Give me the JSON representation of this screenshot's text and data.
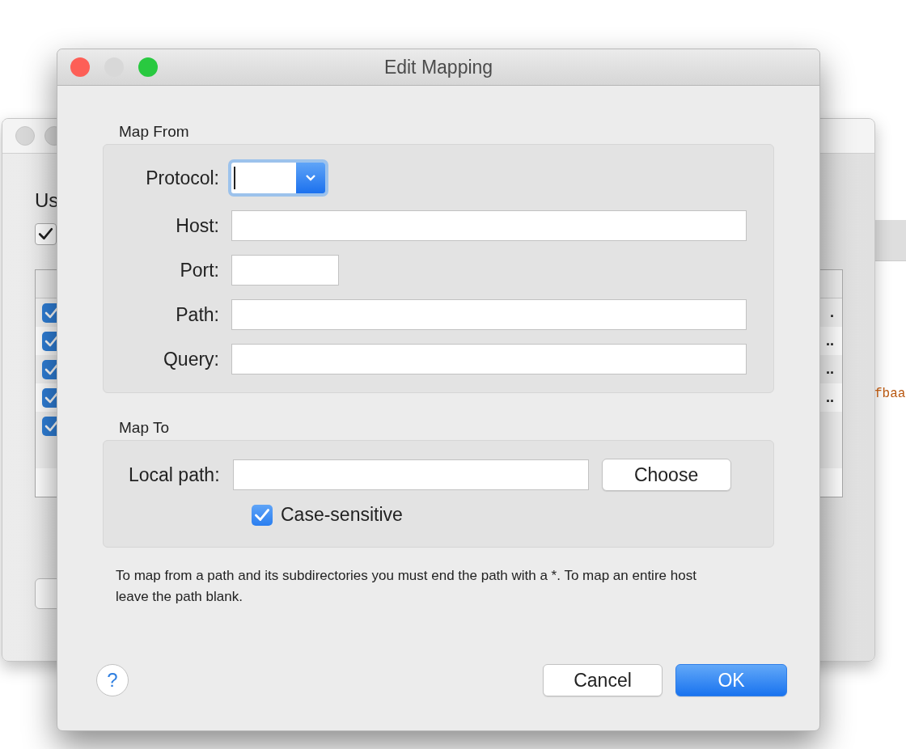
{
  "background_window": {
    "heading": "Us",
    "option_checked": true,
    "rows": [
      {
        "checked": true,
        "text": "."
      },
      {
        "checked": true,
        "text": ".."
      },
      {
        "checked": true,
        "text": ".."
      },
      {
        "checked": true,
        "text": ".."
      },
      {
        "checked": true,
        "text": ""
      }
    ]
  },
  "third_window": {
    "text": "fbaa"
  },
  "dialog": {
    "title": "Edit Mapping",
    "map_from": {
      "title": "Map From",
      "protocol": {
        "label": "Protocol:",
        "focused": true
      },
      "fields": [
        {
          "label": "Host:",
          "kind": "wide"
        },
        {
          "label": "Port:",
          "kind": "short"
        },
        {
          "label": "Path:",
          "kind": "wide"
        },
        {
          "label": "Query:",
          "kind": "wide"
        }
      ]
    },
    "map_to": {
      "title": "Map To",
      "local_path_label": "Local path:",
      "choose_button": "Choose",
      "case_sensitive": {
        "label": "Case-sensitive",
        "checked": true
      }
    },
    "hint": "To map from a path and its subdirectories you must end the path with a *. To map an entire host leave the path blank.",
    "help_button": "?",
    "buttons": [
      {
        "label": "Cancel",
        "kind": "normal"
      },
      {
        "label": "OK",
        "kind": "default"
      }
    ]
  }
}
